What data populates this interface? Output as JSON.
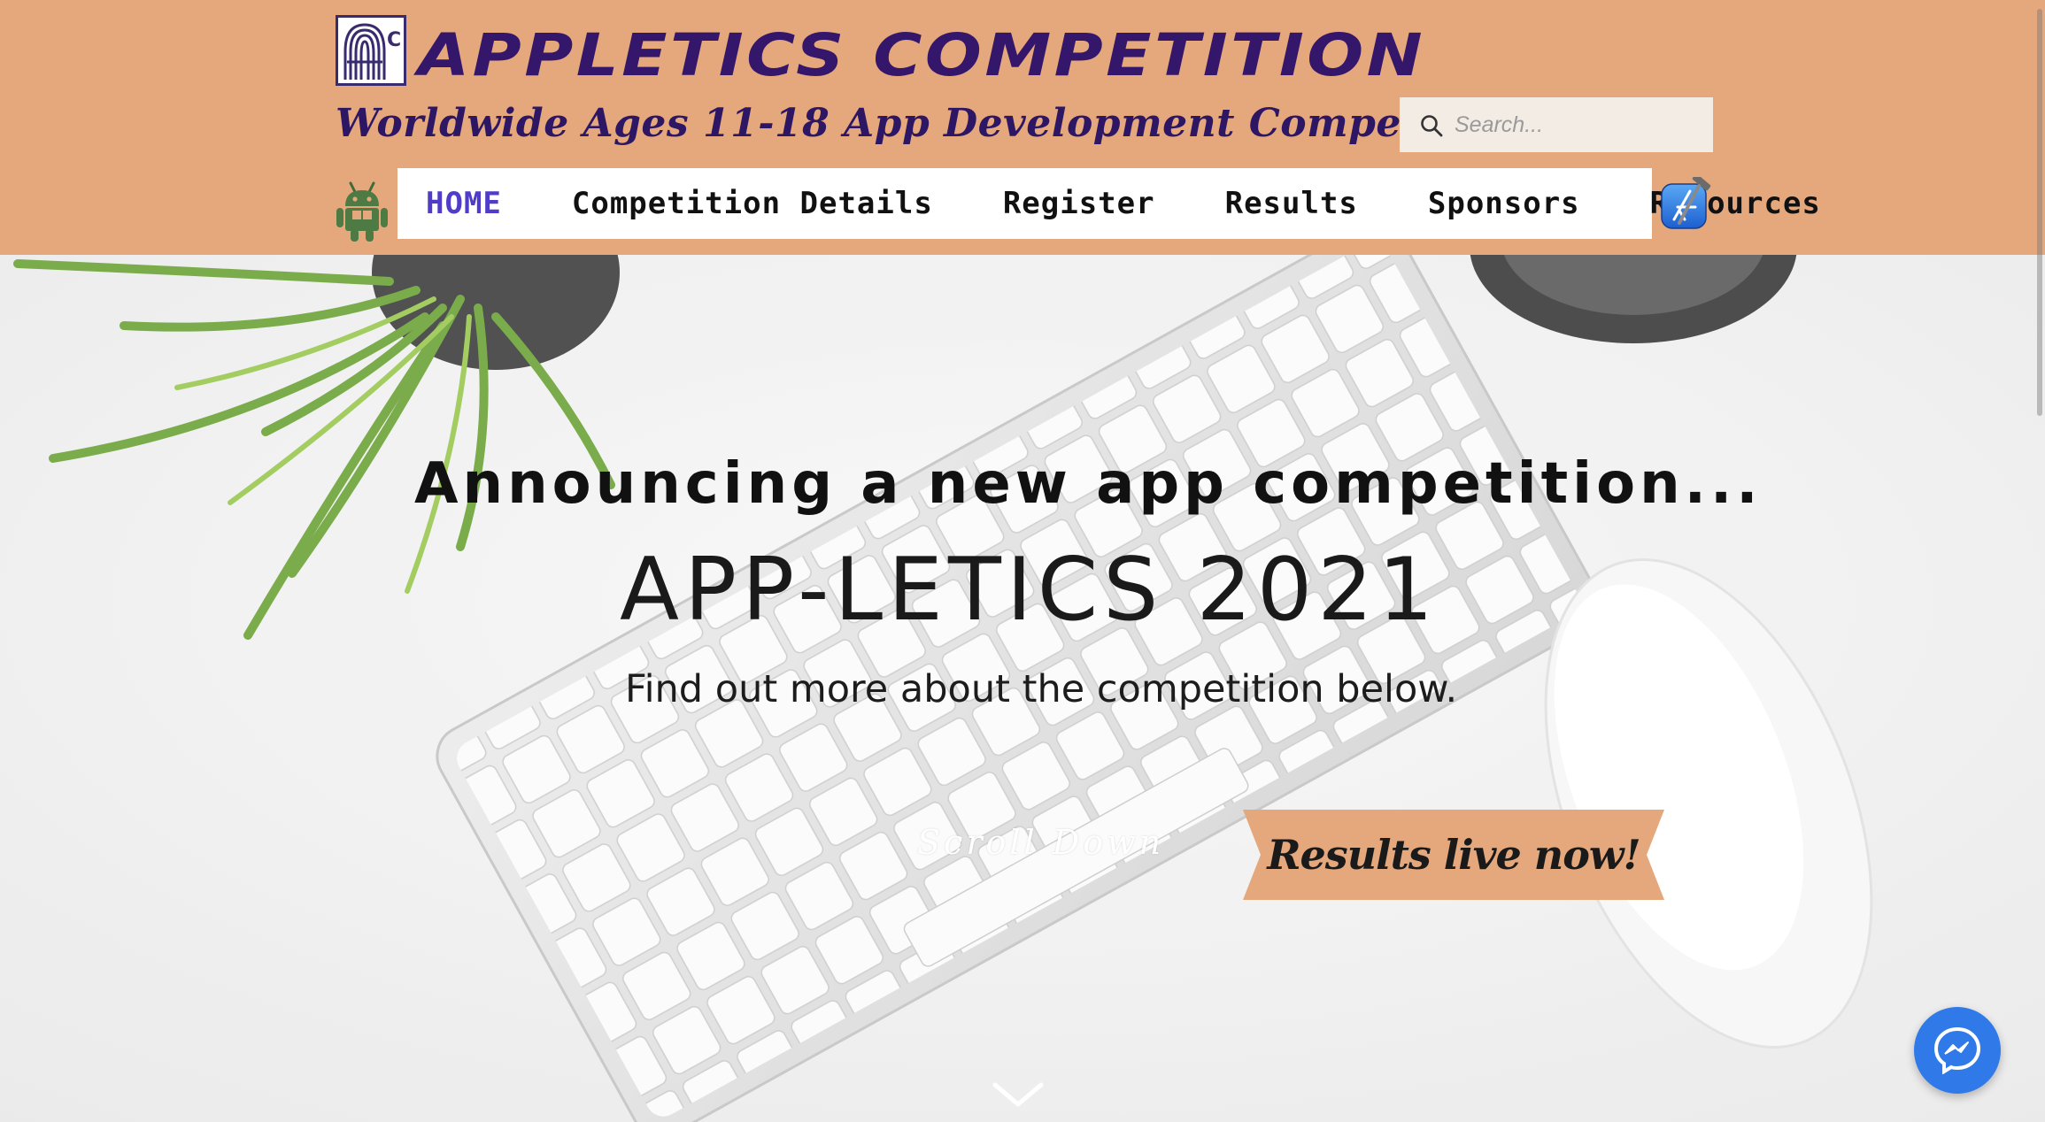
{
  "header": {
    "logo_letters": "AC",
    "logo_title": "APPLETICS COMPETITION",
    "tagline": "Worldwide Ages 11-18 App Development Competition",
    "bg_color": "#e5a77c",
    "brand_color": "#34166a"
  },
  "search": {
    "placeholder": "Search...",
    "value": ""
  },
  "nav": {
    "items": [
      {
        "label": "HOME",
        "active": true
      },
      {
        "label": "Competition Details",
        "active": false
      },
      {
        "label": "Register",
        "active": false
      },
      {
        "label": "Results",
        "active": false
      },
      {
        "label": "Sponsors",
        "active": false
      },
      {
        "label": "Resources",
        "active": false
      }
    ],
    "active_color": "#4f3cc9"
  },
  "icons": {
    "left_nav_icon": "android-icon",
    "right_nav_icon": "xcode-icon",
    "search": "search-icon",
    "scroll": "chevron-down-icon",
    "chat": "messenger-icon"
  },
  "hero": {
    "announcement": "Announcing a new app competition...",
    "title": "APP-LETICS 2021",
    "subtitle": "Find out more about the competition below.",
    "scroll_label": "Scroll Down",
    "results_button": "Results live now!"
  }
}
